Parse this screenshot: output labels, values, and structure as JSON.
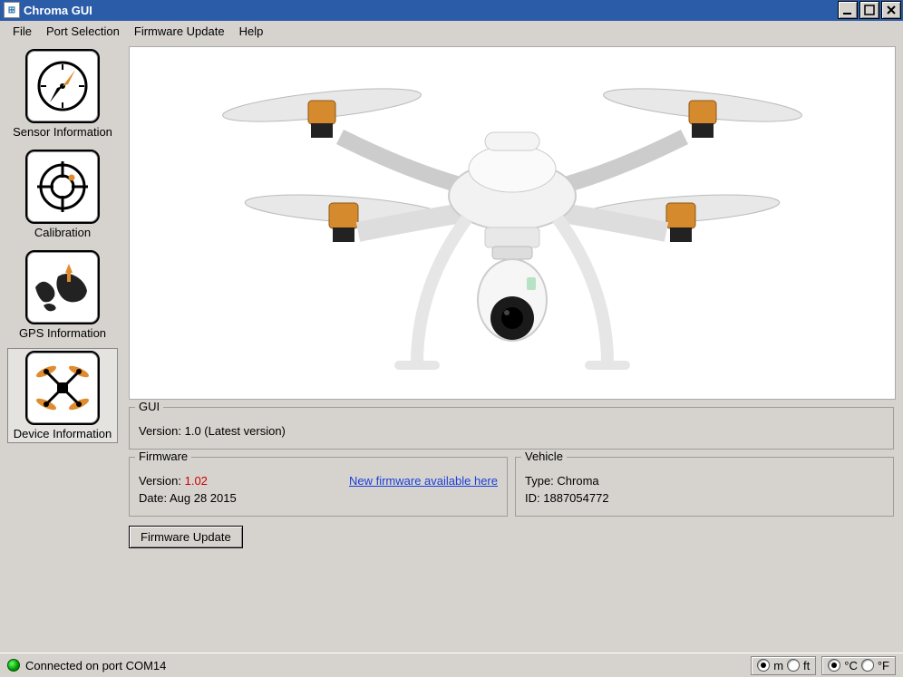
{
  "window": {
    "title": "Chroma GUI"
  },
  "menu": {
    "file": "File",
    "port": "Port Selection",
    "firmware": "Firmware Update",
    "help": "Help"
  },
  "sidebar": {
    "sensor": "Sensor Information",
    "calibration": "Calibration",
    "gps": "GPS Information",
    "device": "Device Information"
  },
  "gui": {
    "legend": "GUI",
    "version_label": "Version:",
    "version_value": "1.0 (Latest version)"
  },
  "firmware": {
    "legend": "Firmware",
    "version_label": "Version:",
    "version_value": "1.02",
    "link": "New firmware available here",
    "date_label": "Date:",
    "date_value": "Aug 28 2015"
  },
  "vehicle": {
    "legend": "Vehicle",
    "type_label": "Type:",
    "type_value": "Chroma",
    "id_label": "ID:",
    "id_value": "1887054772"
  },
  "buttons": {
    "firmware_update": "Firmware Update"
  },
  "status": {
    "text": "Connected on port COM14"
  },
  "units": {
    "m": "m",
    "ft": "ft",
    "c": "°C",
    "f": "°F"
  }
}
